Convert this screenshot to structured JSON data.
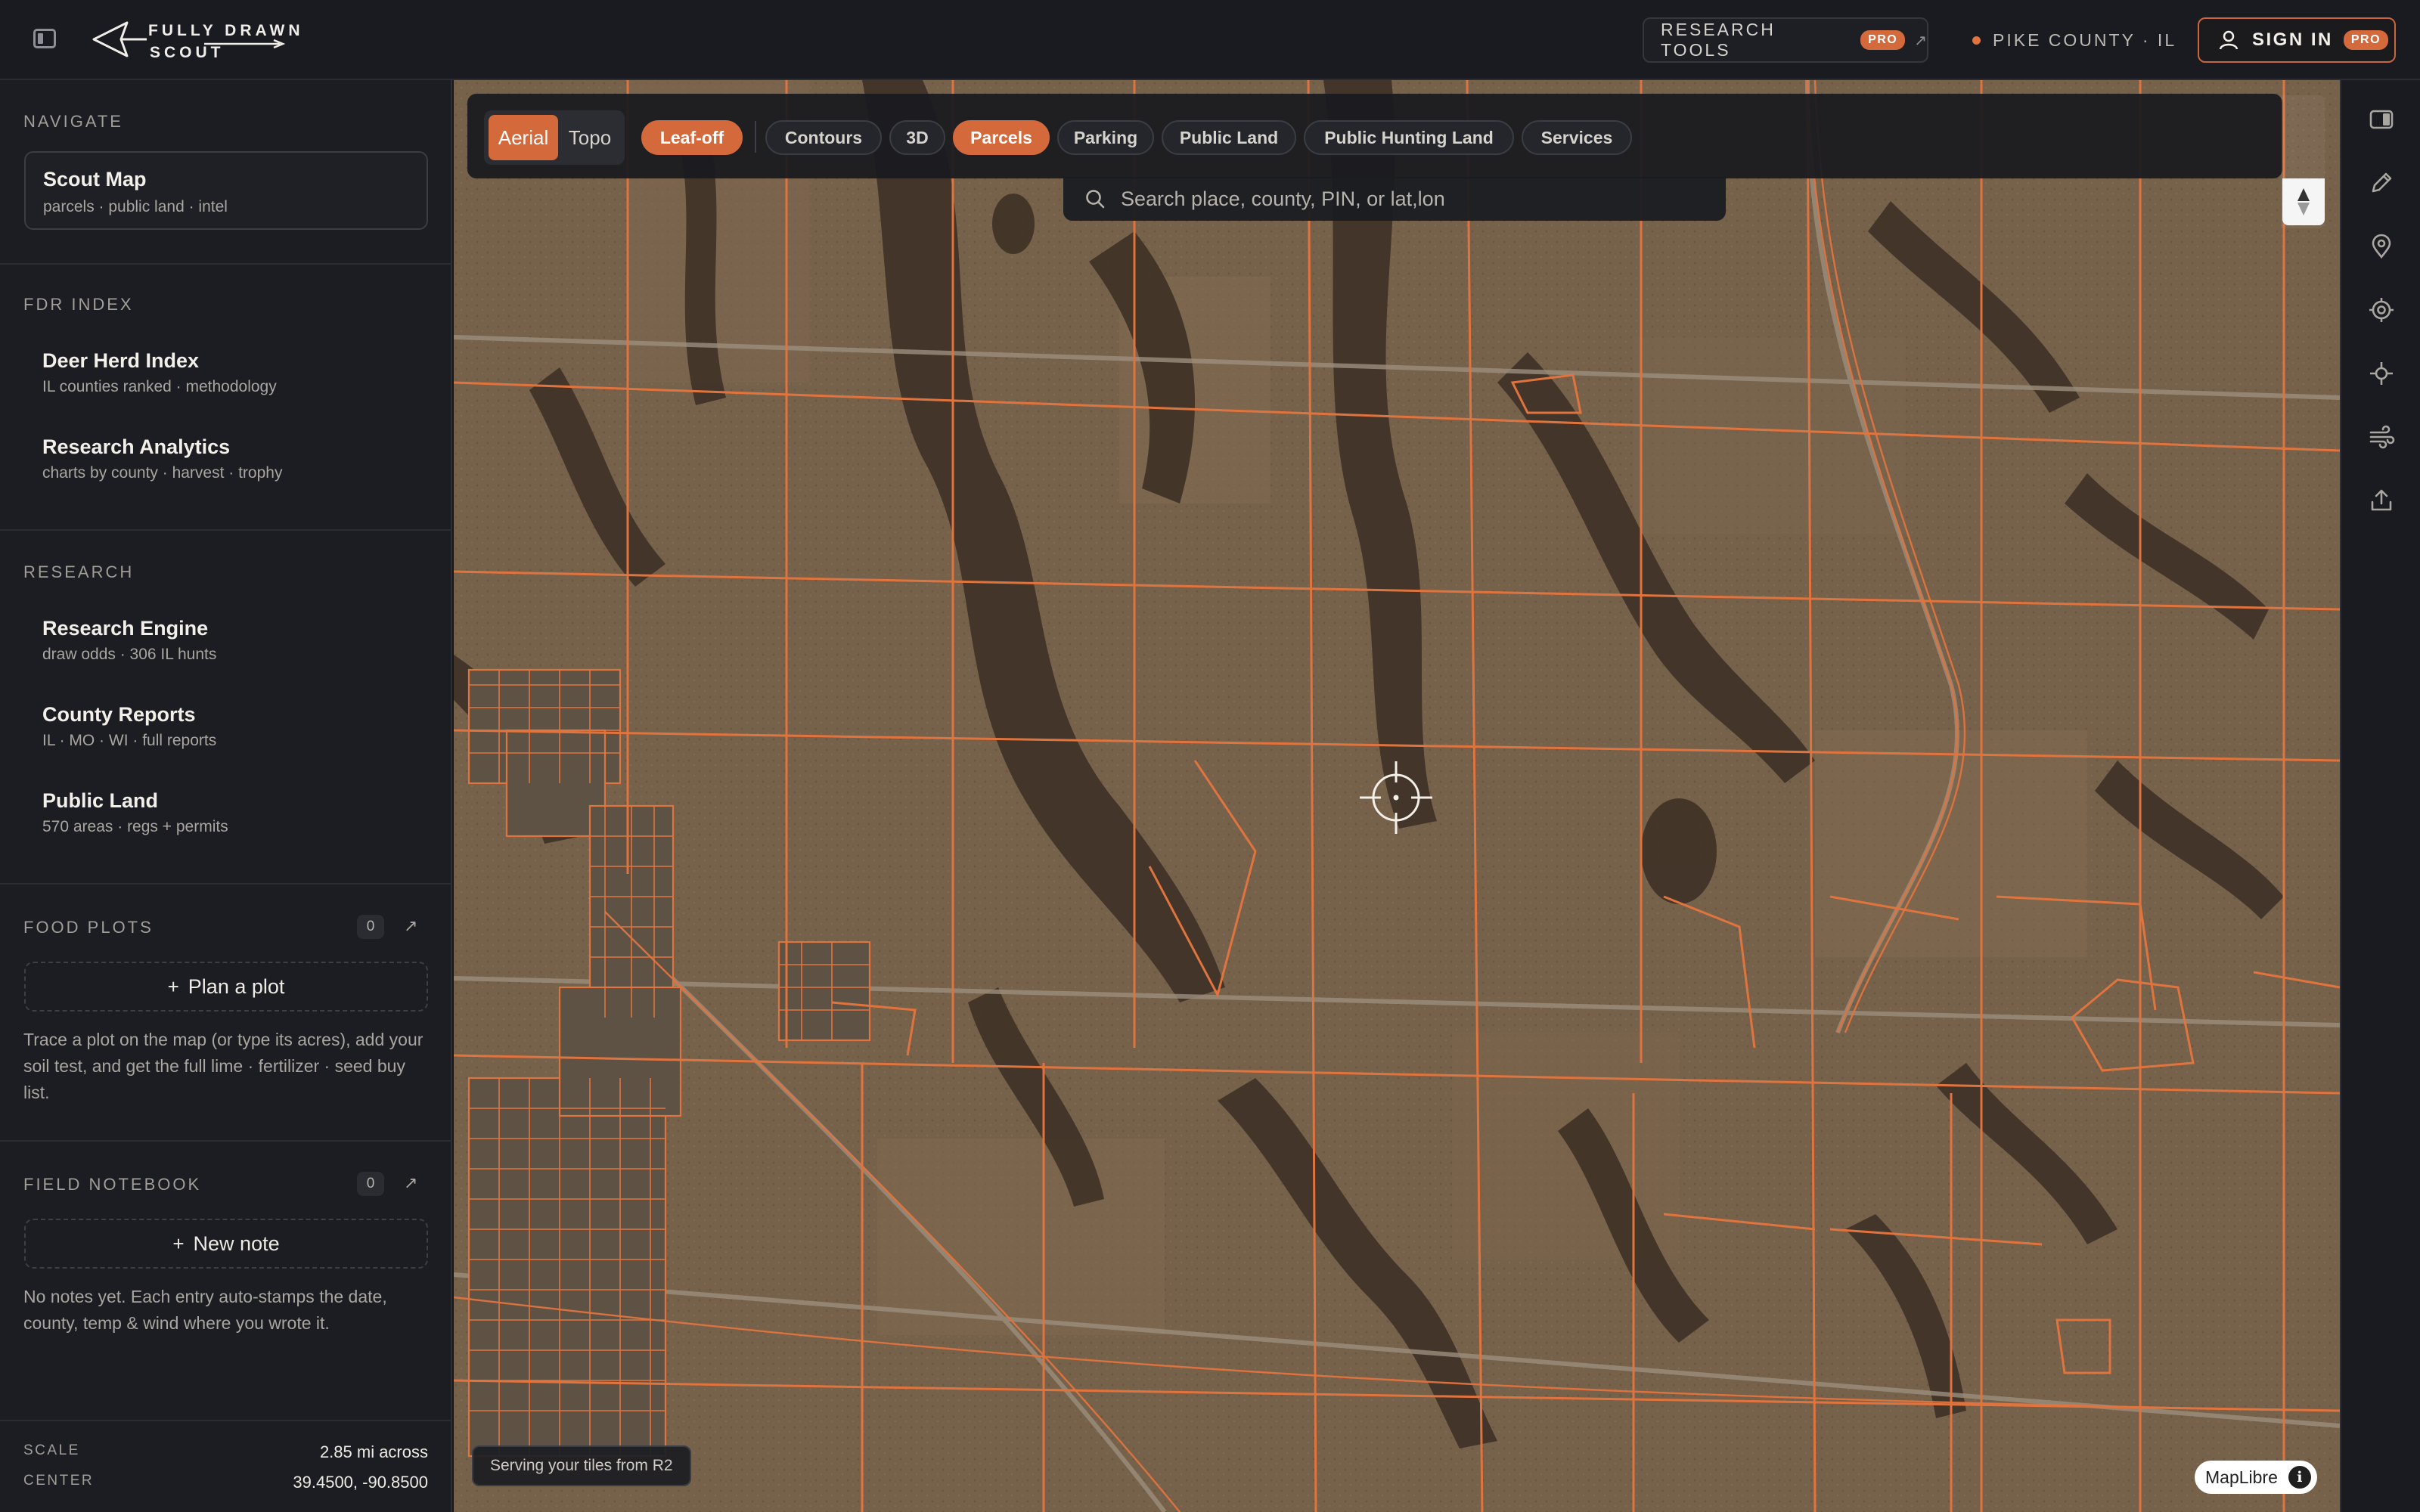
{
  "header": {
    "logo_line1": "FULLY DRAWN",
    "logo_line2": "SCOUT",
    "research_tools_label": "RESEARCH TOOLS",
    "research_tools_badge": "PRO",
    "research_tools_arrow": "↗",
    "county_label": "PIKE COUNTY · IL",
    "sign_in_label": "SIGN IN",
    "sign_in_badge": "PRO",
    "status_dot_color": "#e0743f"
  },
  "sidebar": {
    "navigate": {
      "label": "NAVIGATE",
      "scout_map": {
        "title": "Scout Map",
        "subtitle": "parcels · public land · intel"
      }
    },
    "fdr_index": {
      "label": "FDR INDEX",
      "items": [
        {
          "title": "Deer Herd Index",
          "subtitle": "IL counties ranked · methodology"
        },
        {
          "title": "Research Analytics",
          "subtitle": "charts by county · harvest · trophy"
        }
      ]
    },
    "research": {
      "label": "RESEARCH",
      "items": [
        {
          "title": "Research Engine",
          "subtitle": "draw odds · 306 IL hunts"
        },
        {
          "title": "County Reports",
          "subtitle": "IL · MO · WI · full reports"
        },
        {
          "title": "Public Land",
          "subtitle": "570 areas · regs + permits"
        }
      ]
    },
    "food_plots": {
      "label": "FOOD PLOTS",
      "count": "0",
      "arrow": "↗",
      "button_label": "Plan a plot",
      "help": "Trace a plot on the map (or type its acres), add your soil test, and get the full lime · fertilizer · seed buy list."
    },
    "field_notebook": {
      "label": "FIELD NOTEBOOK",
      "count": "0",
      "arrow": "↗",
      "button_label": "New note",
      "help": "No notes yet. Each entry auto-stamps the date, county, temp & wind where you wrote it."
    },
    "footer": {
      "scale_label": "SCALE",
      "scale_value": "2.85 mi across",
      "center_label": "CENTER",
      "center_value": "39.4500, -90.8500"
    }
  },
  "map": {
    "basemaps": [
      {
        "label": "Aerial",
        "active": true
      },
      {
        "label": "Topo",
        "active": false
      }
    ],
    "leaf_off_label": "Leaf-off",
    "layers": [
      {
        "label": "Contours",
        "active": false
      },
      {
        "label": "3D",
        "active": false
      },
      {
        "label": "Parcels",
        "active": true
      },
      {
        "label": "Parking",
        "active": false
      },
      {
        "label": "Public Land",
        "active": false
      },
      {
        "label": "Public Hunting Land",
        "active": false
      },
      {
        "label": "Services",
        "active": false
      }
    ],
    "search_placeholder": "Search place, county, PIN, or lat,lon",
    "tiles_status": "Serving your tiles from R2",
    "attribution": "MapLibre",
    "attribution_info": "i",
    "parcel_color": "#e0743f",
    "accent_color": "#d4693c"
  },
  "right_toolbar": {
    "tools": [
      "panel-icon",
      "pencil-icon",
      "map-pin-icon",
      "target-icon",
      "crosshair-icon",
      "wind-icon",
      "share-icon"
    ]
  }
}
